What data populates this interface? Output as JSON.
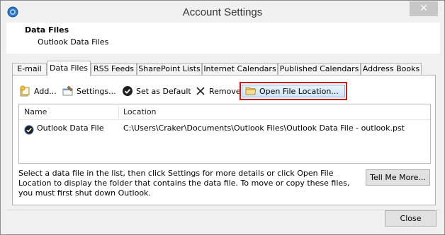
{
  "window": {
    "title": "Account Settings",
    "close_glyph": "✕"
  },
  "header": {
    "title": "Data Files",
    "subtitle": "Outlook Data Files"
  },
  "tabs": [
    {
      "label": "E-mail",
      "active": false
    },
    {
      "label": "Data Files",
      "active": true
    },
    {
      "label": "RSS Feeds",
      "active": false
    },
    {
      "label": "SharePoint Lists",
      "active": false
    },
    {
      "label": "Internet Calendars",
      "active": false
    },
    {
      "label": "Published Calendars",
      "active": false
    },
    {
      "label": "Address Books",
      "active": false
    }
  ],
  "toolbar": {
    "add_label": "Add...",
    "settings_label": "Settings...",
    "default_label": "Set as Default",
    "remove_label": "Remove",
    "open_location_label": "Open File Location..."
  },
  "list": {
    "columns": [
      "Name",
      "Location"
    ],
    "rows": [
      {
        "name": "Outlook Data File",
        "location": "C:\\Users\\Craker\\Documents\\Outlook Files\\Outlook Data File - outlook.pst",
        "is_default": true
      }
    ]
  },
  "description": "Select a data file in the list, then click Settings for more details or click Open File Location to display the folder that contains the data file. To move or copy these files, you must first shut down Outlook.",
  "buttons": {
    "tell_me_more": "Tell Me More...",
    "close": "Close"
  },
  "colors": {
    "highlight_border": "#cc1a1a",
    "accent_blue": "#1a5fa8"
  }
}
